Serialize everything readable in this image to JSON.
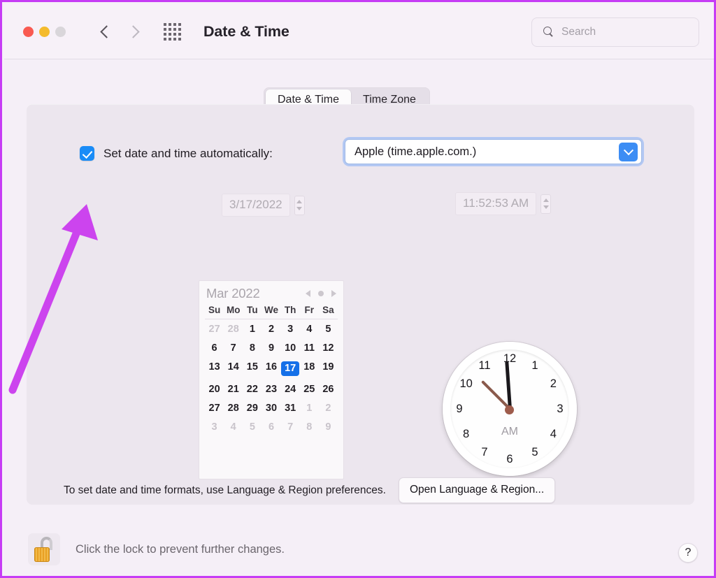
{
  "window": {
    "title": "Date & Time",
    "traffic_lights": [
      "close",
      "minimize",
      "zoom"
    ],
    "colors": {
      "accent_blue": "#1a8cf7",
      "annotation": "#cc44ee",
      "panel_bg": "#ece6ee",
      "window_bg": "#f5eff7",
      "selected_day": "#1570e8"
    }
  },
  "toolbar": {
    "back_icon": "chevron-left-icon",
    "forward_icon": "chevron-right-icon",
    "grid_icon": "grid-view-icon",
    "search": {
      "placeholder": "Search",
      "value": "",
      "icon": "search-icon"
    }
  },
  "tabs": [
    {
      "label": "Date & Time",
      "selected": true
    },
    {
      "label": "Time Zone",
      "selected": false
    }
  ],
  "auto_row": {
    "checkbox_checked": true,
    "label": "Set date and time automatically:",
    "server": {
      "value": "Apple (time.apple.com.)",
      "options": [
        "Apple (time.apple.com.)"
      ],
      "dropdown_icon": "chevron-down-icon",
      "focused": true
    }
  },
  "date_field": {
    "value": "3/17/2022",
    "enabled": false,
    "stepper_icon": "stepper-arrows-icon"
  },
  "time_field": {
    "value": "11:52:53 AM",
    "enabled": false,
    "stepper_icon": "stepper-arrows-icon"
  },
  "calendar": {
    "month_label": "Mar 2022",
    "prev_icon": "triangle-left-icon",
    "today_icon": "circle-icon",
    "next_icon": "triangle-right-icon",
    "weekdays": [
      "Su",
      "Mo",
      "Tu",
      "We",
      "Th",
      "Fr",
      "Sa"
    ],
    "selected_day": 17,
    "weeks": [
      [
        {
          "d": "27",
          "out": true
        },
        {
          "d": "28",
          "out": true
        },
        {
          "d": "1"
        },
        {
          "d": "2"
        },
        {
          "d": "3"
        },
        {
          "d": "4"
        },
        {
          "d": "5"
        }
      ],
      [
        {
          "d": "6"
        },
        {
          "d": "7"
        },
        {
          "d": "8"
        },
        {
          "d": "9"
        },
        {
          "d": "10"
        },
        {
          "d": "11"
        },
        {
          "d": "12"
        }
      ],
      [
        {
          "d": "13"
        },
        {
          "d": "14"
        },
        {
          "d": "15"
        },
        {
          "d": "16"
        },
        {
          "d": "17",
          "sel": true
        },
        {
          "d": "18"
        },
        {
          "d": "19"
        }
      ],
      [
        {
          "d": "20"
        },
        {
          "d": "21"
        },
        {
          "d": "22"
        },
        {
          "d": "23"
        },
        {
          "d": "24"
        },
        {
          "d": "25"
        },
        {
          "d": "26"
        }
      ],
      [
        {
          "d": "27"
        },
        {
          "d": "28"
        },
        {
          "d": "29"
        },
        {
          "d": "30"
        },
        {
          "d": "31"
        },
        {
          "d": "1",
          "out": true
        },
        {
          "d": "2",
          "out": true
        }
      ],
      [
        {
          "d": "3",
          "out": true
        },
        {
          "d": "4",
          "out": true
        },
        {
          "d": "5",
          "out": true
        },
        {
          "d": "6",
          "out": true
        },
        {
          "d": "7",
          "out": true
        },
        {
          "d": "8",
          "out": true
        },
        {
          "d": "9",
          "out": true
        }
      ]
    ]
  },
  "clock": {
    "numerals": [
      "12",
      "1",
      "2",
      "3",
      "4",
      "5",
      "6",
      "7",
      "8",
      "9",
      "10",
      "11"
    ],
    "meridiem": "AM",
    "displayed_time": "11:52:53 AM"
  },
  "format_row": {
    "text": "To set date and time formats, use Language & Region preferences.",
    "button_label": "Open Language & Region..."
  },
  "lock_row": {
    "icon": "unlocked-padlock-icon",
    "text": "Click the lock to prevent further changes."
  },
  "help_button": {
    "label": "?",
    "icon": "help-icon"
  },
  "annotation": {
    "type": "arrow",
    "points_to": "set-date-time-automatically-checkbox"
  }
}
